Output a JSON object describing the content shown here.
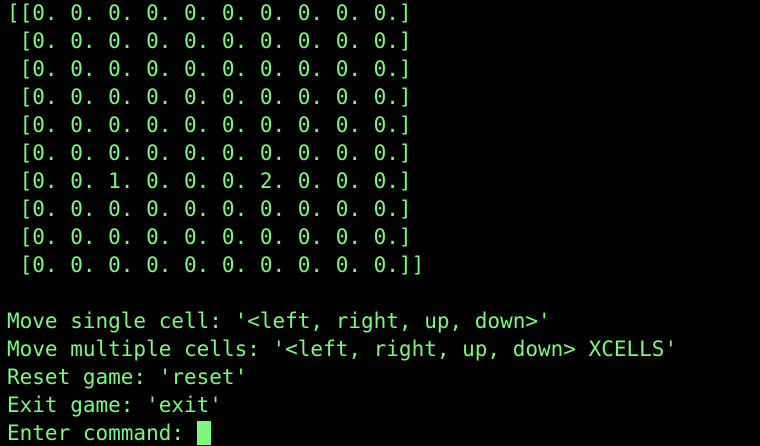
{
  "terminal": {
    "colors": {
      "background": "#000000",
      "foreground": "#7cf87c",
      "cursor": "#7cf87c"
    },
    "grid_rows": [
      "[[0. 0. 0. 0. 0. 0. 0. 0. 0. 0.]",
      " [0. 0. 0. 0. 0. 0. 0. 0. 0. 0.]",
      " [0. 0. 0. 0. 0. 0. 0. 0. 0. 0.]",
      " [0. 0. 0. 0. 0. 0. 0. 0. 0. 0.]",
      " [0. 0. 0. 0. 0. 0. 0. 0. 0. 0.]",
      " [0. 0. 0. 0. 0. 0. 0. 0. 0. 0.]",
      " [0. 0. 1. 0. 0. 0. 2. 0. 0. 0.]",
      " [0. 0. 0. 0. 0. 0. 0. 0. 0. 0.]",
      " [0. 0. 0. 0. 0. 0. 0. 0. 0. 0.]",
      " [0. 0. 0. 0. 0. 0. 0. 0. 0. 0.]]"
    ],
    "instructions": {
      "move_single": "Move single cell: '<left, right, up, down>'",
      "move_multiple": "Move multiple cells: '<left, right, up, down> XCELLS'",
      "reset": "Reset game: 'reset'",
      "exit": "Exit game: 'exit'"
    },
    "prompt": "Enter command: "
  }
}
